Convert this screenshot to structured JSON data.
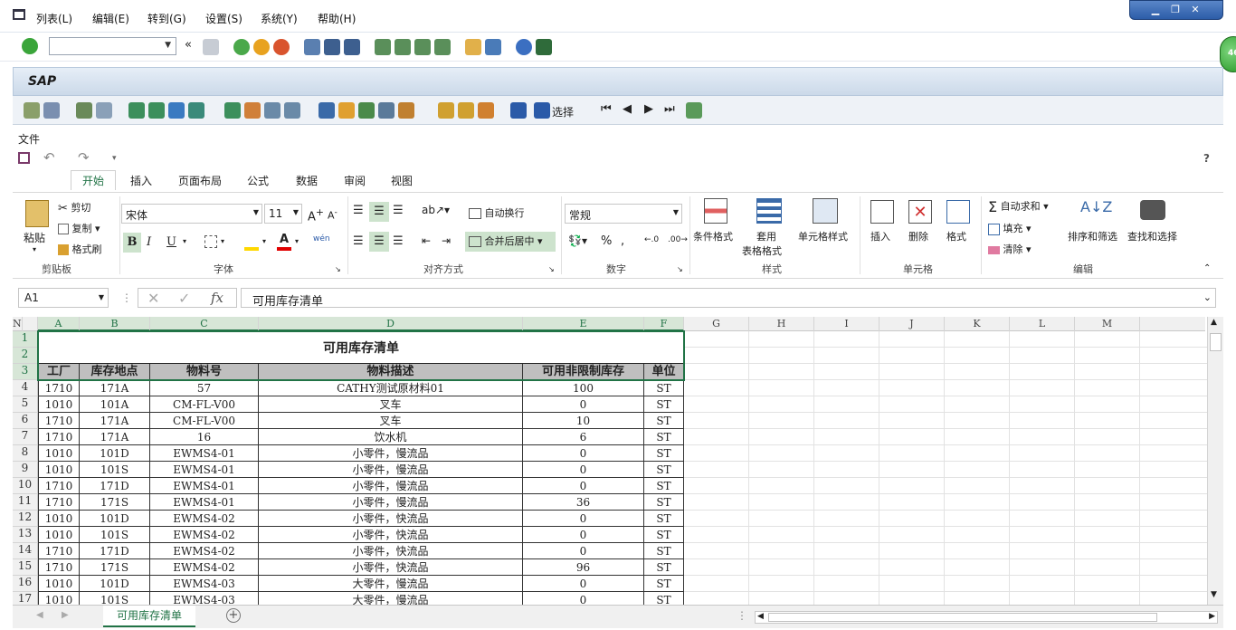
{
  "menubar": {
    "items": [
      "列表(L)",
      "编辑(E)",
      "转到(G)",
      "设置(S)",
      "系统(Y)",
      "帮助(H)"
    ]
  },
  "window_controls": {
    "minimize": "▁",
    "restore": "❐",
    "close": "✕"
  },
  "sap": {
    "title": "SAP",
    "select_label": "选择",
    "badge": "46"
  },
  "excel": {
    "file_menu": "文件",
    "help": "?",
    "tabs": [
      "开始",
      "插入",
      "页面布局",
      "公式",
      "数据",
      "审阅",
      "视图"
    ],
    "clipboard": {
      "paste": "粘贴",
      "cut": "剪切",
      "copy": "复制",
      "format_painter": "格式刷",
      "group": "剪贴板"
    },
    "font": {
      "name": "宋体",
      "size": "11",
      "bold": "B",
      "italic": "I",
      "underline": "U",
      "group": "字体"
    },
    "alignment": {
      "wrap": "自动换行",
      "merge": "合并后居中",
      "group": "对齐方式"
    },
    "number": {
      "format": "常规",
      "group": "数字"
    },
    "styles": {
      "conditional": "条件格式",
      "table_format_1": "套用",
      "table_format_2": "表格格式",
      "cell_styles": "单元格样式",
      "group": "样式"
    },
    "cells": {
      "insert": "插入",
      "delete": "删除",
      "format": "格式",
      "group": "单元格"
    },
    "editing": {
      "autosum": "自动求和",
      "fill": "填充",
      "clear": "清除",
      "sort": "排序和筛选",
      "find": "查找和选择",
      "group": "编辑"
    },
    "name_box": "A1",
    "formula_value": "可用库存清单",
    "sheet_tab": "可用库存清单"
  },
  "sheet": {
    "columns": [
      "A",
      "B",
      "C",
      "D",
      "E",
      "F",
      "G",
      "H",
      "I",
      "J",
      "K",
      "L",
      "M",
      "N"
    ],
    "row_numbers": [
      "1",
      "2",
      "3",
      "4",
      "5",
      "6",
      "7",
      "8",
      "9",
      "10",
      "11",
      "12",
      "13",
      "14",
      "15",
      "16",
      "17"
    ],
    "title": "可用库存清单",
    "headers": [
      "工厂",
      "库存地点",
      "物料号",
      "物料描述",
      "可用非限制库存",
      "单位"
    ],
    "rows": [
      [
        "1710",
        "171A",
        "57",
        "CATHY测试原材料01",
        "100",
        "ST"
      ],
      [
        "1010",
        "101A",
        "CM-FL-V00",
        "叉车",
        "0",
        "ST"
      ],
      [
        "1710",
        "171A",
        "CM-FL-V00",
        "叉车",
        "10",
        "ST"
      ],
      [
        "1710",
        "171A",
        "16",
        "饮水机",
        "6",
        "ST"
      ],
      [
        "1010",
        "101D",
        "EWMS4-01",
        "小零件，慢流品",
        "0",
        "ST"
      ],
      [
        "1010",
        "101S",
        "EWMS4-01",
        "小零件，慢流品",
        "0",
        "ST"
      ],
      [
        "1710",
        "171D",
        "EWMS4-01",
        "小零件，慢流品",
        "0",
        "ST"
      ],
      [
        "1710",
        "171S",
        "EWMS4-01",
        "小零件，慢流品",
        "36",
        "ST"
      ],
      [
        "1010",
        "101D",
        "EWMS4-02",
        "小零件，快流品",
        "0",
        "ST"
      ],
      [
        "1010",
        "101S",
        "EWMS4-02",
        "小零件，快流品",
        "0",
        "ST"
      ],
      [
        "1710",
        "171D",
        "EWMS4-02",
        "小零件，快流品",
        "0",
        "ST"
      ],
      [
        "1710",
        "171S",
        "EWMS4-02",
        "小零件，快流品",
        "96",
        "ST"
      ],
      [
        "1010",
        "101D",
        "EWMS4-03",
        "大零件，慢流品",
        "0",
        "ST"
      ],
      [
        "1010",
        "101S",
        "EWMS4-03",
        "大零件，慢流品",
        "0",
        "ST"
      ]
    ]
  }
}
